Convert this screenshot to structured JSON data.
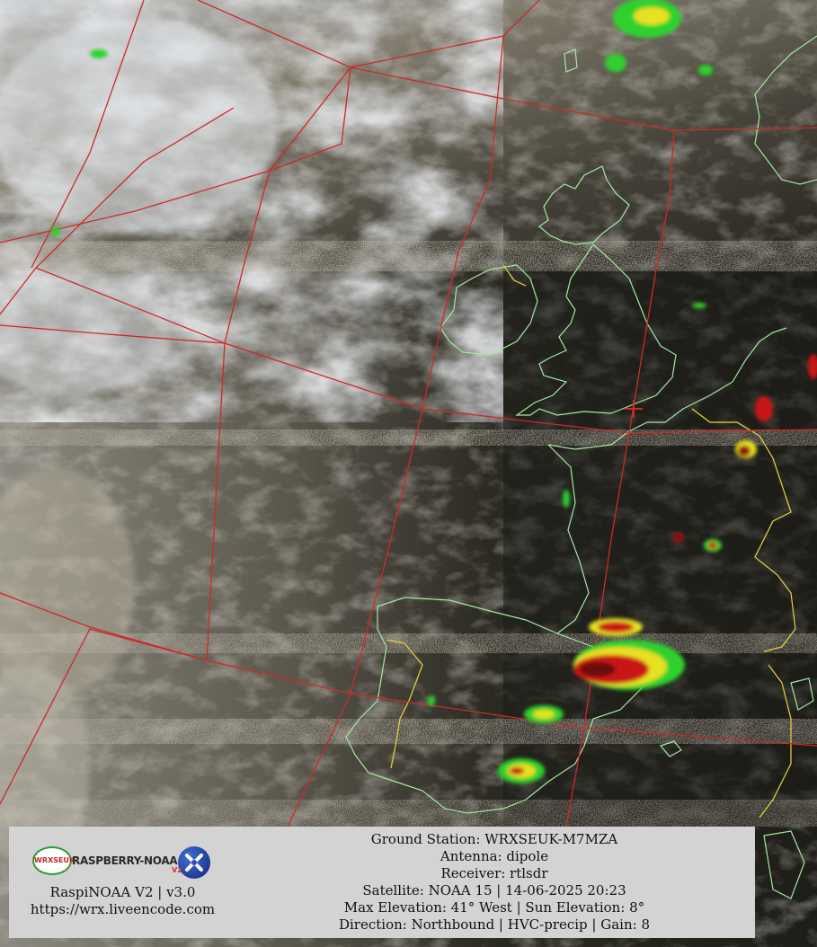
{
  "image": {
    "description_icon": "weather-satellite-image",
    "colors": {
      "grid": "#cc2a2a",
      "coastline": "#a6e8a0",
      "border": "#e6d640",
      "cloud": "#d2d6dc",
      "sea": "#222018",
      "precip_green": "#2fd12f",
      "precip_yellow": "#e8e020",
      "precip_red": "#c81818"
    }
  },
  "info_panel": {
    "logos": {
      "wrx": "WRXSEUK",
      "raspberry": "RASPBERRY-NOAA",
      "version_badge": "V2"
    },
    "software": "RaspiNOAA V2 | v3.0",
    "url": "https://wrx.liveencode.com",
    "lines": [
      "Ground Station: WRXSEUK-M7MZA",
      "Antenna: dipole",
      "Receiver: rtlsdr",
      "Satellite: NOAA 15 | 14-06-2025 20:23",
      "Max Elevation: 41° West | Sun Elevation: 8°",
      "Direction: Northbound | HVC-precip | Gain: 8"
    ]
  }
}
